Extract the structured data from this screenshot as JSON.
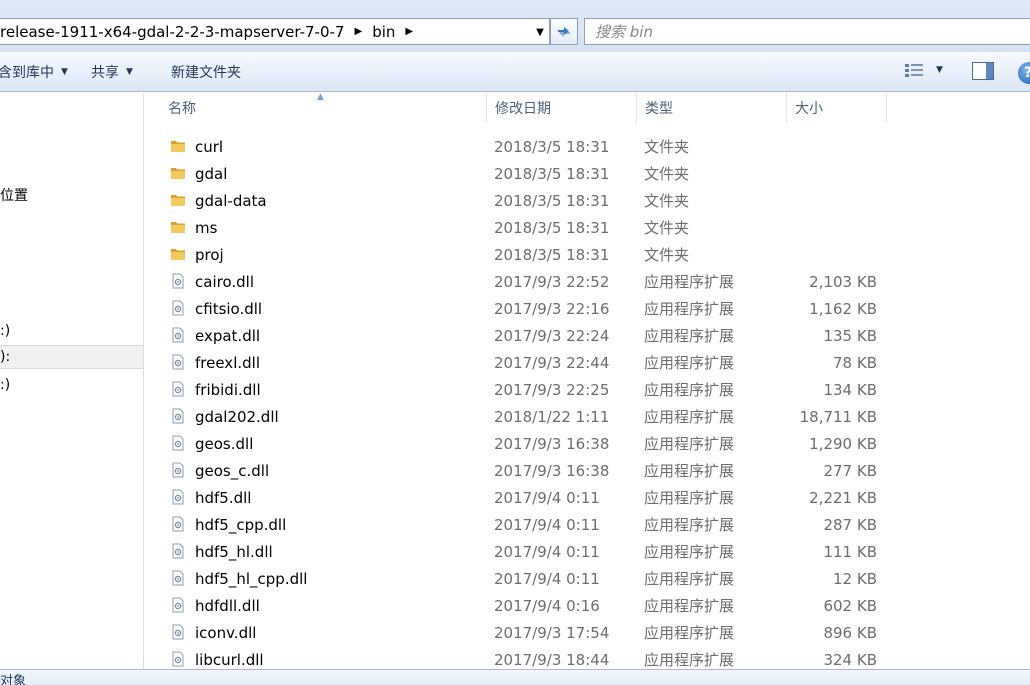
{
  "address_bar": {
    "crumbs": [
      "release-1911-x64-gdal-2-2-3-mapserver-7-0-7",
      "bin"
    ],
    "search_placeholder": "搜索 bin"
  },
  "toolbar": {
    "include_in_library": "包含到库中",
    "share": "共享",
    "new_folder": "新建文件夹"
  },
  "nav_pane": {
    "items": [
      {
        "label": "位置"
      },
      {
        "label": ":)"
      },
      {
        "label": "):"
      },
      {
        "label": ":)"
      }
    ]
  },
  "columns": {
    "name": "名称",
    "date": "修改日期",
    "type": "类型",
    "size": "大小"
  },
  "files": [
    {
      "name": "curl",
      "date": "2018/3/5 18:31",
      "type": "文件夹",
      "size": "",
      "icon": "folder-icon"
    },
    {
      "name": "gdal",
      "date": "2018/3/5 18:31",
      "type": "文件夹",
      "size": "",
      "icon": "folder-icon"
    },
    {
      "name": "gdal-data",
      "date": "2018/3/5 18:31",
      "type": "文件夹",
      "size": "",
      "icon": "folder-icon"
    },
    {
      "name": "ms",
      "date": "2018/3/5 18:31",
      "type": "文件夹",
      "size": "",
      "icon": "folder-icon"
    },
    {
      "name": "proj",
      "date": "2018/3/5 18:31",
      "type": "文件夹",
      "size": "",
      "icon": "folder-icon"
    },
    {
      "name": "cairo.dll",
      "date": "2017/9/3 22:52",
      "type": "应用程序扩展",
      "size": "2,103 KB",
      "icon": "dll-icon"
    },
    {
      "name": "cfitsio.dll",
      "date": "2017/9/3 22:16",
      "type": "应用程序扩展",
      "size": "1,162 KB",
      "icon": "dll-icon"
    },
    {
      "name": "expat.dll",
      "date": "2017/9/3 22:24",
      "type": "应用程序扩展",
      "size": "135 KB",
      "icon": "dll-icon"
    },
    {
      "name": "freexl.dll",
      "date": "2017/9/3 22:44",
      "type": "应用程序扩展",
      "size": "78 KB",
      "icon": "dll-icon"
    },
    {
      "name": "fribidi.dll",
      "date": "2017/9/3 22:25",
      "type": "应用程序扩展",
      "size": "134 KB",
      "icon": "dll-icon"
    },
    {
      "name": "gdal202.dll",
      "date": "2018/1/22 1:11",
      "type": "应用程序扩展",
      "size": "18,711 KB",
      "icon": "dll-icon"
    },
    {
      "name": "geos.dll",
      "date": "2017/9/3 16:38",
      "type": "应用程序扩展",
      "size": "1,290 KB",
      "icon": "dll-icon"
    },
    {
      "name": "geos_c.dll",
      "date": "2017/9/3 16:38",
      "type": "应用程序扩展",
      "size": "277 KB",
      "icon": "dll-icon"
    },
    {
      "name": "hdf5.dll",
      "date": "2017/9/4 0:11",
      "type": "应用程序扩展",
      "size": "2,221 KB",
      "icon": "dll-icon"
    },
    {
      "name": "hdf5_cpp.dll",
      "date": "2017/9/4 0:11",
      "type": "应用程序扩展",
      "size": "287 KB",
      "icon": "dll-icon"
    },
    {
      "name": "hdf5_hl.dll",
      "date": "2017/9/4 0:11",
      "type": "应用程序扩展",
      "size": "111 KB",
      "icon": "dll-icon"
    },
    {
      "name": "hdf5_hl_cpp.dll",
      "date": "2017/9/4 0:11",
      "type": "应用程序扩展",
      "size": "12 KB",
      "icon": "dll-icon"
    },
    {
      "name": "hdfdll.dll",
      "date": "2017/9/4 0:16",
      "type": "应用程序扩展",
      "size": "602 KB",
      "icon": "dll-icon"
    },
    {
      "name": "iconv.dll",
      "date": "2017/9/3 17:54",
      "type": "应用程序扩展",
      "size": "896 KB",
      "icon": "dll-icon"
    },
    {
      "name": "libcurl.dll",
      "date": "2017/9/3 18:44",
      "type": "应用程序扩展",
      "size": "324 KB",
      "icon": "dll-icon"
    }
  ],
  "status_bar": {
    "text": "对象"
  },
  "colors": {
    "toolbar_text": "#1e395b",
    "folder": "#e8b33a",
    "secondary_text": "#6d6d6d"
  }
}
